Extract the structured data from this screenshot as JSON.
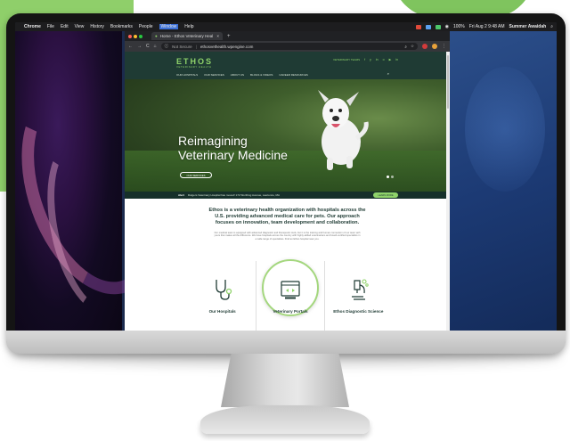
{
  "mac_menu": {
    "app": "Chrome",
    "items": [
      "File",
      "Edit",
      "View",
      "History",
      "Bookmarks",
      "People",
      "Window",
      "Help"
    ],
    "status": "Fri Aug 2 9:48 AM",
    "user": "Summer Awaidah",
    "battery": "100%"
  },
  "browser": {
    "tab_title": "Home - Ethos Veterinary Heal",
    "new_tab": "+",
    "security": "Not Secure",
    "url": "ethosvethealth.wpengine.com"
  },
  "site": {
    "logo": "ETHOS",
    "logo_sub": "VETERINARY HEALTH",
    "nav": [
      "OUR HOSPITALS",
      "OUR SERVICES",
      "ABOUT US",
      "BLOGS & VIDEOS",
      "CAREER RESOURCES"
    ],
    "nav_right_label": "VETERINARY TEAMS",
    "social": [
      "f",
      "y",
      "in",
      "o",
      "▶",
      "in"
    ],
    "hero_title_line1": "Reimagining",
    "hero_title_line2": "Veterinary Medicine",
    "hero_button": "OUR SERVICES",
    "alert_label": "Alert",
    "alert_text": "Rutgers Veterinary Hospital has moved! 172 Worthing Avenue, Lawrence, MA",
    "alert_button": "LEARN MORE",
    "intro_heading": "Ethos is a veterinary health organization with hospitals across the U.S. providing advanced medical care for pets. Our approach focuses on innovation, team development and collaboration.",
    "intro_body": "Our medical team is equipped with advanced diagnostic and therapeutic tools, but it is the training and human connection of our team with yours that makes all the difference. We have hospitals across the country with highly-skilled veterinarians and board-certified specialists in a wide range of specialties. Find an Ethos hospital near you.",
    "cards": [
      {
        "label": "Our Hospitals",
        "icon": "stethoscope-icon"
      },
      {
        "label": "Veterinary Portals",
        "icon": "portal-window-icon"
      },
      {
        "label": "Ethos Diagnostic Science",
        "icon": "microscope-icon"
      }
    ]
  },
  "colors": {
    "brand_dark": "#1f3b34",
    "brand_green": "#8fd36a",
    "accent_bg": "#8fcf6a"
  }
}
